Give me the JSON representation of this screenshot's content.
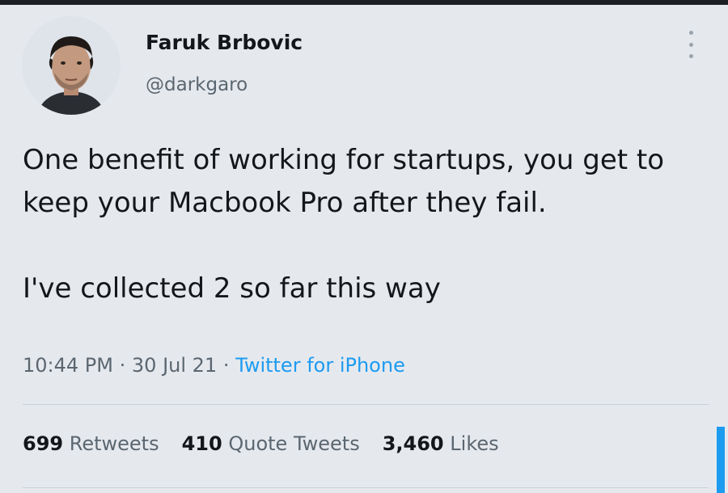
{
  "tweet": {
    "author": {
      "display_name": "Faruk Brbovic",
      "handle": "@darkgaro"
    },
    "text_paragraphs": [
      "One benefit of working for startups, you get to keep your Macbook Pro after they fail.",
      "I've collected 2 so far this way"
    ],
    "time": "10:44 PM",
    "date": "30 Jul 21",
    "separator": "·",
    "source": "Twitter for iPhone",
    "stats": [
      {
        "count": "699",
        "label": "Retweets"
      },
      {
        "count": "410",
        "label": "Quote Tweets"
      },
      {
        "count": "3,460",
        "label": "Likes"
      }
    ]
  },
  "icons": {
    "more": "more-vertical-icon"
  },
  "colors": {
    "background": "#e5e9ee",
    "text": "#14171a",
    "secondary_text": "#5b6670",
    "link": "#1d9bf0"
  }
}
